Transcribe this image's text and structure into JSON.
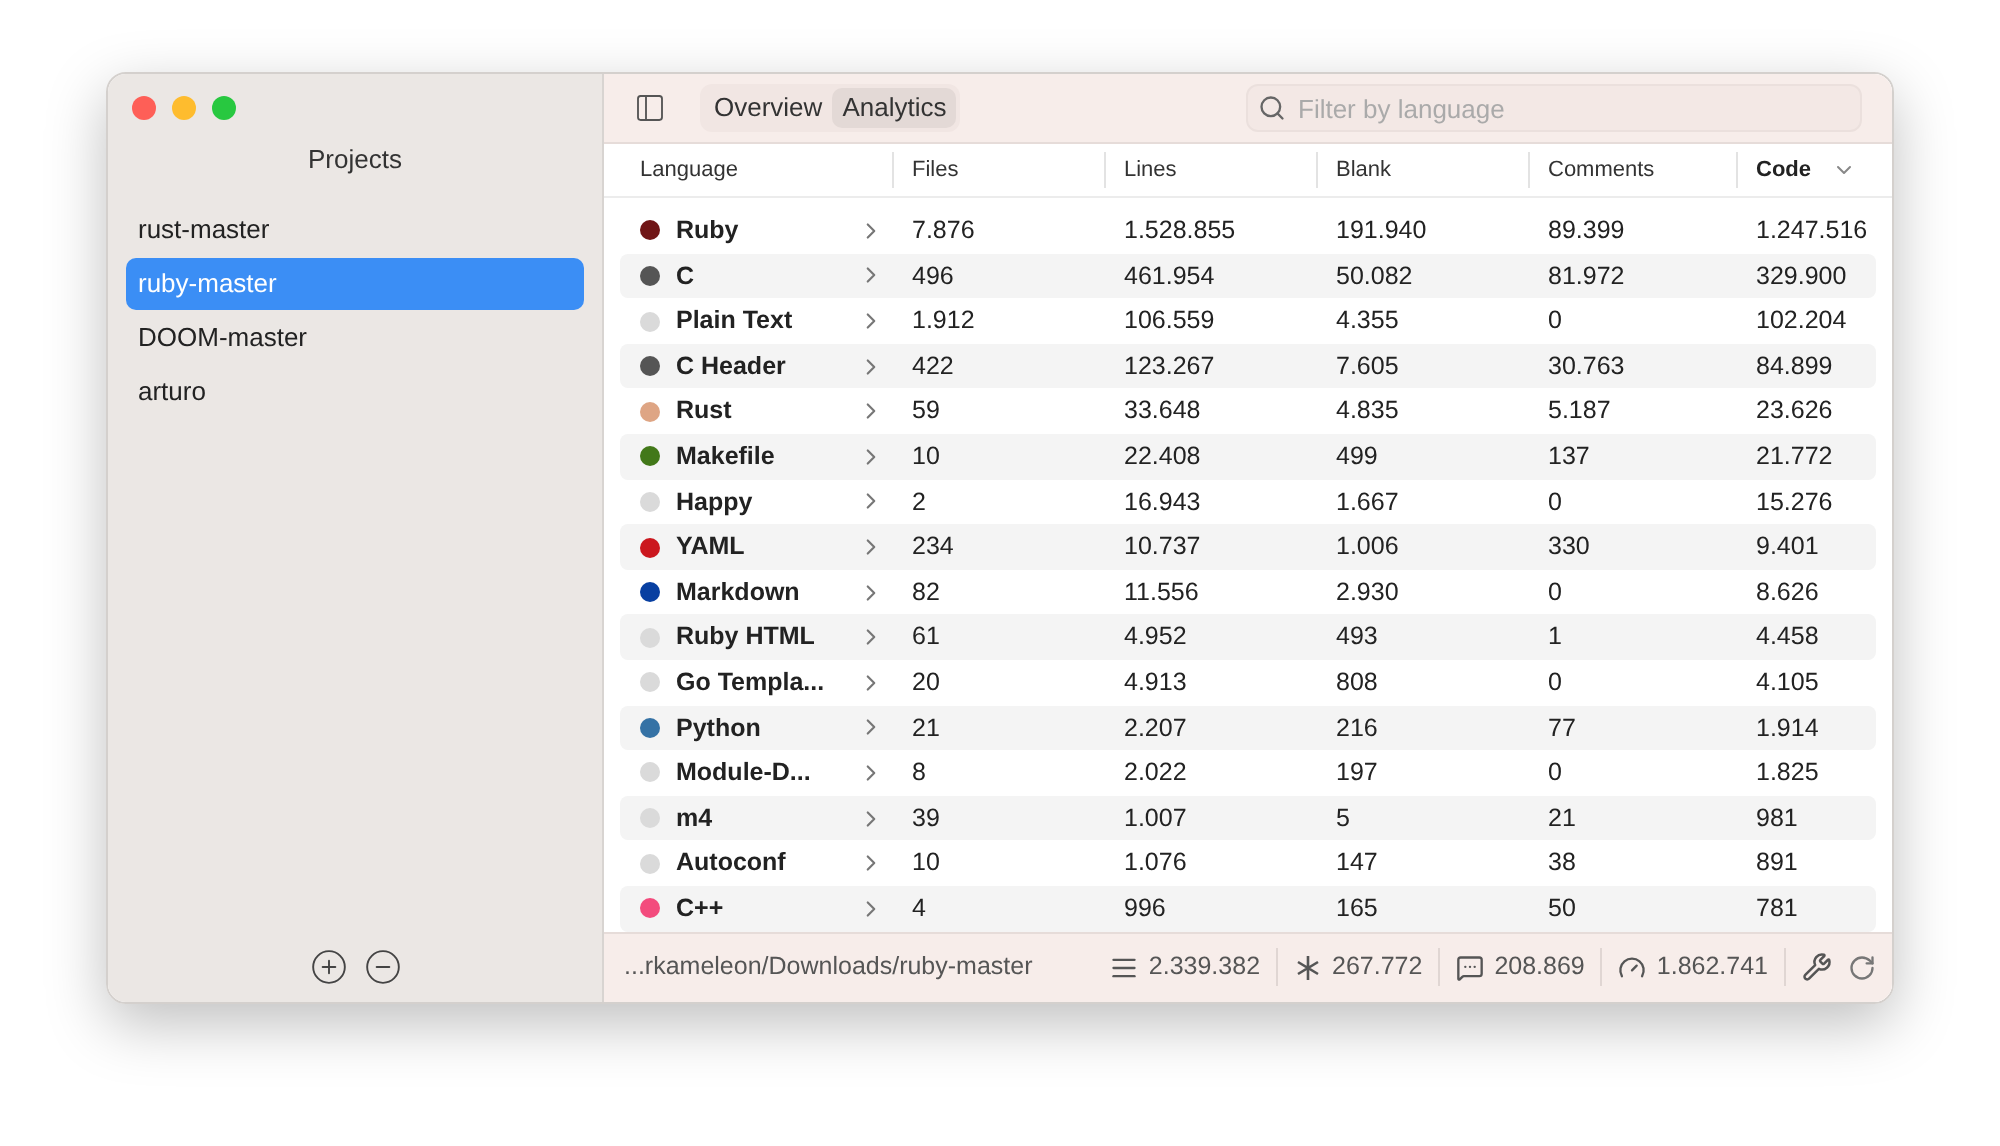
{
  "sidebar": {
    "title": "Projects",
    "items": [
      {
        "label": "rust-master",
        "selected": false
      },
      {
        "label": "ruby-master",
        "selected": true
      },
      {
        "label": "DOOM-master",
        "selected": false
      },
      {
        "label": "arturo",
        "selected": false
      }
    ]
  },
  "tabs": [
    {
      "label": "Overview",
      "selected": false
    },
    {
      "label": "Analytics",
      "selected": true
    }
  ],
  "search": {
    "placeholder": "Filter by language"
  },
  "table": {
    "columns": [
      {
        "label": "Language",
        "sorted": false
      },
      {
        "label": "Files",
        "sorted": false
      },
      {
        "label": "Lines",
        "sorted": false
      },
      {
        "label": "Blank",
        "sorted": false
      },
      {
        "label": "Comments",
        "sorted": false
      },
      {
        "label": "Code",
        "sorted": true
      }
    ],
    "rows": [
      {
        "color": "#701516",
        "cells": [
          "Ruby",
          "7.876",
          "1.528.855",
          "191.940",
          "89.399",
          "1.247.516"
        ]
      },
      {
        "color": "#555555",
        "cells": [
          "C",
          "496",
          "461.954",
          "50.082",
          "81.972",
          "329.900"
        ]
      },
      {
        "color": "#dadada",
        "cells": [
          "Plain Text",
          "1.912",
          "106.559",
          "4.355",
          "0",
          "102.204"
        ]
      },
      {
        "color": "#555555",
        "cells": [
          "C Header",
          "422",
          "123.267",
          "7.605",
          "30.763",
          "84.899"
        ]
      },
      {
        "color": "#dea584",
        "cells": [
          "Rust",
          "59",
          "33.648",
          "4.835",
          "5.187",
          "23.626"
        ]
      },
      {
        "color": "#427819",
        "cells": [
          "Makefile",
          "10",
          "22.408",
          "499",
          "137",
          "21.772"
        ]
      },
      {
        "color": "#dadada",
        "cells": [
          "Happy",
          "2",
          "16.943",
          "1.667",
          "0",
          "15.276"
        ]
      },
      {
        "color": "#cb171e",
        "cells": [
          "YAML",
          "234",
          "10.737",
          "1.006",
          "330",
          "9.401"
        ]
      },
      {
        "color": "#083fa1",
        "cells": [
          "Markdown",
          "82",
          "11.556",
          "2.930",
          "0",
          "8.626"
        ]
      },
      {
        "color": "#dadada",
        "cells": [
          "Ruby HTML",
          "61",
          "4.952",
          "493",
          "1",
          "4.458"
        ]
      },
      {
        "color": "#dadada",
        "cells": [
          "Go Templa...",
          "20",
          "4.913",
          "808",
          "0",
          "4.105"
        ]
      },
      {
        "color": "#3572a5",
        "cells": [
          "Python",
          "21",
          "2.207",
          "216",
          "77",
          "1.914"
        ]
      },
      {
        "color": "#dadada",
        "cells": [
          "Module-D...",
          "8",
          "2.022",
          "197",
          "0",
          "1.825"
        ]
      },
      {
        "color": "#dadada",
        "cells": [
          "m4",
          "39",
          "1.007",
          "5",
          "21",
          "981"
        ]
      },
      {
        "color": "#dadada",
        "cells": [
          "Autoconf",
          "10",
          "1.076",
          "147",
          "38",
          "891"
        ]
      },
      {
        "color": "#f34b7d",
        "cells": [
          "C++",
          "4",
          "996",
          "165",
          "50",
          "781"
        ]
      }
    ]
  },
  "status_bar": {
    "path": "...rkameleon/Downloads/ruby-master",
    "stats": [
      {
        "kind": "lines",
        "value": "2.339.382"
      },
      {
        "kind": "blank",
        "value": "267.772"
      },
      {
        "kind": "comments",
        "value": "208.869"
      },
      {
        "kind": "code",
        "value": "1.862.741"
      }
    ]
  }
}
